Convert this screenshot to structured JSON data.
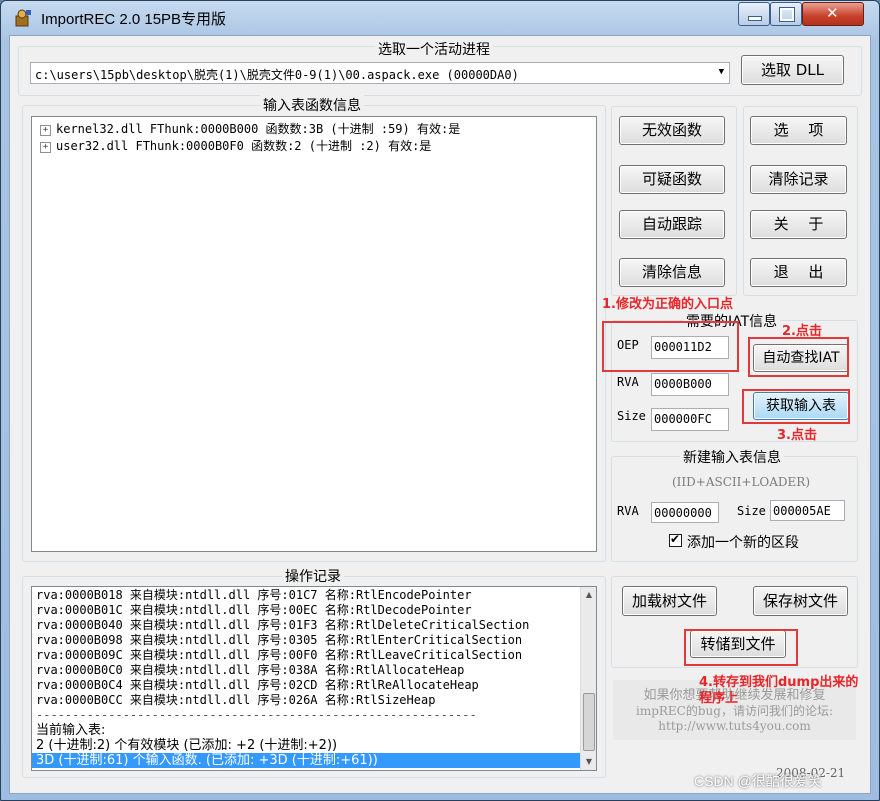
{
  "window": {
    "title": "ImportREC 2.0 15PB专用版"
  },
  "process": {
    "group_title": "选取一个活动进程",
    "selected": "c:\\users\\15pb\\desktop\\脱壳(1)\\脱壳文件0-9(1)\\00.aspack.exe  (00000DA0)",
    "pick_dll_label": "选取 DLL"
  },
  "imports": {
    "group_title": "输入表函数信息",
    "items": [
      {
        "text": "kernel32.dll FThunk:0000B000 函数数:3B (十进制 :59) 有效:是"
      },
      {
        "text": "user32.dll FThunk:0000B0F0 函数数:2 (十进制 :2) 有效:是"
      }
    ]
  },
  "buttons": {
    "invalid_funcs": "无效函数",
    "suspect_funcs": "可疑函数",
    "auto_trace": "自动跟踪",
    "clear_info": "清除信息",
    "options": "选　 项",
    "clear_log": "清除记录",
    "about": "关　 于",
    "exit": "退　 出",
    "load_tree": "加载树文件",
    "save_tree": "保存树文件",
    "dump_to_file": "转储到文件"
  },
  "iat": {
    "group_title": "需要的IAT信息",
    "oep_label": "OEP",
    "oep_value": "000011D2",
    "rva_label": "RVA",
    "rva_value": "0000B000",
    "size_label": "Size",
    "size_value": "000000FC",
    "auto_find_label": "自动查找IAT",
    "get_imports_label": "获取输入表"
  },
  "new_import": {
    "group_title": "新建输入表信息",
    "subtitle": "(IID+ASCII+LOADER)",
    "rva_label": "RVA",
    "rva_value": "00000000",
    "size_label": "Size",
    "size_value": "000005AE",
    "add_section_label": "添加一个新的区段",
    "add_section_checked": true
  },
  "log": {
    "group_title": "操作记录",
    "rows": [
      "rva:0000B018 来自模块:ntdll.dll 序号:01C7 名称:RtlEncodePointer",
      "rva:0000B01C 来自模块:ntdll.dll 序号:00EC 名称:RtlDecodePointer",
      "rva:0000B040 来自模块:ntdll.dll 序号:01F3 名称:RtlDeleteCriticalSection",
      "rva:0000B098 来自模块:ntdll.dll 序号:0305 名称:RtlEnterCriticalSection",
      "rva:0000B09C 来自模块:ntdll.dll 序号:00F0 名称:RtlLeaveCriticalSection",
      "rva:0000B0C0 来自模块:ntdll.dll 序号:038A 名称:RtlAllocateHeap",
      "rva:0000B0C4 来自模块:ntdll.dll 序号:02CD 名称:RtlReAllocateHeap",
      "rva:0000B0CC 来自模块:ntdll.dll 序号:026A 名称:RtlSizeHeap"
    ],
    "separator": "-------------------------------------------------------------",
    "current_label": "当前输入表:",
    "summary_modules": "2 (十进制:2) 个有效模块 (已添加: +2 (十进制:+2))",
    "summary_funcs": "3D (十进制:61) 个输入函数. (已添加: +3D (十进制:+61))"
  },
  "footer": {
    "line1": "如果你想要帮助继续发展和修复",
    "line2": "impREC的bug，请访问我们的论坛:",
    "line3": "http://www.tuts4you.com",
    "date": "2008-02-21",
    "watermark": "CSDN @很酷很爱笑"
  },
  "annotations": {
    "step1": "1.修改为正确的入口点",
    "step2": "2.点击",
    "step3": "3.点击",
    "step4_line1": "4.转存到我们dump出来的",
    "step4_line2": "程序上"
  },
  "colors": {
    "annotation_red": "#e8262a",
    "selection_blue": "#3399ff"
  }
}
